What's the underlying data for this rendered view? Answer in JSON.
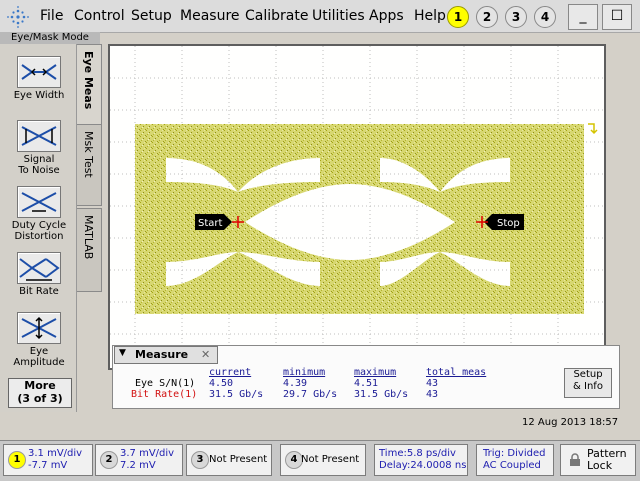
{
  "menu": {
    "items": [
      "File",
      "Control",
      "Setup",
      "Measure",
      "Calibrate",
      "Utilities",
      "Apps",
      "Help"
    ],
    "channels": [
      "1",
      "2",
      "3",
      "4"
    ],
    "window_buttons": {
      "minimize": "_",
      "close": "☐"
    }
  },
  "mode_label": "Eye/Mask Mode",
  "tabs": {
    "eye_meas": "Eye Meas",
    "msk_test": "Msk Test",
    "matlab": "MATLAB"
  },
  "tools": [
    {
      "label_line1": "Eye Width",
      "label_line2": ""
    },
    {
      "label_line1": "Signal",
      "label_line2": "To Noise"
    },
    {
      "label_line1": "Duty Cycle",
      "label_line2": "Distortion"
    },
    {
      "label_line1": "Bit Rate",
      "label_line2": ""
    },
    {
      "label_line1": "Eye",
      "label_line2": "Amplitude"
    }
  ],
  "more_button": {
    "line1": "More",
    "line2": "(3 of 3)"
  },
  "markers": {
    "start": "Start",
    "stop": "Stop"
  },
  "measure": {
    "title": "Measure",
    "close": "✕",
    "headers": [
      "current",
      "minimum",
      "maximum",
      "total meas"
    ],
    "rows": [
      {
        "label": "Eye S/N(1)",
        "current": "4.50",
        "minimum": "4.39",
        "maximum": "4.51",
        "total": "43"
      },
      {
        "label": "Bit Rate(1)",
        "current": "31.5 Gb/s",
        "minimum": "29.7 Gb/s",
        "maximum": "31.5 Gb/s",
        "total": "43"
      }
    ],
    "setup_line1": "Setup",
    "setup_line2": "& Info"
  },
  "datetime": "12 Aug 2013   18:57",
  "status": {
    "ch1": {
      "num": "1",
      "line1": "3.1 mV/div",
      "line2": "-7.7 mV"
    },
    "ch2": {
      "num": "2",
      "line1": "3.7 mV/div",
      "line2": "7.2 mV"
    },
    "ch3": {
      "num": "3",
      "text": "Not Present"
    },
    "ch4": {
      "num": "4",
      "text": "Not Present"
    },
    "time": {
      "line1": "Time:5.8 ps/div",
      "line2": "Delay:24.0008 ns"
    },
    "trig": {
      "line1": "Trig: Divided",
      "line2": "AC Coupled"
    },
    "lock": {
      "line1": "Pattern",
      "line2": "Lock"
    }
  },
  "colors": {
    "trace": "#c9c92c",
    "channel1": "#ffff00",
    "marker": "#e00000",
    "value_text": "#1b1b94"
  }
}
